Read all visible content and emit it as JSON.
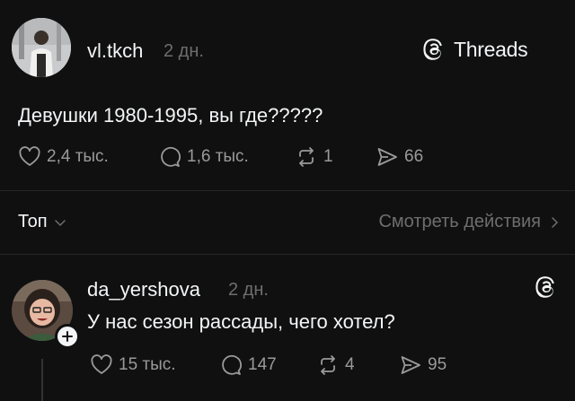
{
  "brand": {
    "name": "Threads"
  },
  "post": {
    "username": "vl.tkch",
    "time": "2 дн.",
    "text": "Девушки 1980-1995, вы где?????",
    "likes": "2,4 тыс.",
    "comments": "1,6 тыс.",
    "reposts": "1",
    "shares": "66"
  },
  "sort": {
    "label": "Топ"
  },
  "activity": {
    "label": "Смотреть действия"
  },
  "reply": {
    "username": "da_yershova",
    "time": "2 дн.",
    "text": "У нас сезон рассады, чего хотел?",
    "likes": "15 тыс.",
    "comments": "147",
    "reposts": "4",
    "shares": "95"
  },
  "colors": {
    "background": "#101010",
    "text": "#f3f5f7",
    "muted": "#6e6e6e",
    "icon": "#9a9a9a"
  },
  "icons": [
    "heart-icon",
    "comment-icon",
    "repost-icon",
    "share-icon",
    "threads-logo-icon",
    "chevron-down-icon",
    "chevron-right-icon",
    "plus-icon"
  ]
}
